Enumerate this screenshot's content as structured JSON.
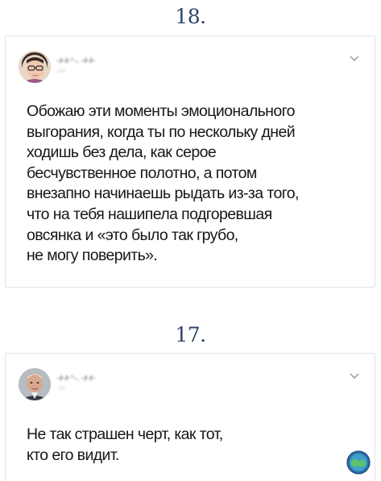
{
  "sections": [
    {
      "number": "18.",
      "tweet": {
        "author_name": "·/·/·'·. ·/·/·",
        "author_handle": "·/·/·",
        "text": "Обожаю эти моменты эмоционального\nвыгорания, когда ты по нескольку дней\nходишь без дела, как серое\nбесчувственное полотно, а потом\nвнезапно начинаешь рыдать из-за того,\nчто на тебя нашипела подгоревшая\nовсянка и «это было так грубо,\nне могу поверить».",
        "avatar_icon": "avatar-photo-icon",
        "menu_icon": "chevron-down-icon"
      }
    },
    {
      "number": "17.",
      "tweet": {
        "author_name": "·/·/·'·. ·/·/·",
        "author_handle": "·/·/·",
        "text": "Не так страшен черт, как тот,\nкто его видит.",
        "avatar_icon": "avatar-photo-icon",
        "menu_icon": "chevron-down-icon"
      }
    }
  ],
  "watermark_icon": "globe-logo-icon",
  "colors": {
    "number": "#2f4468",
    "text": "#14171a",
    "border": "#dfe5ea",
    "muted": "#8899a6"
  }
}
